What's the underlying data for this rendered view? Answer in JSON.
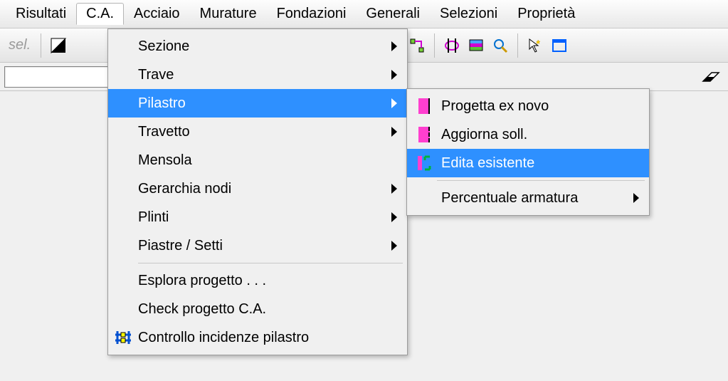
{
  "menubar": {
    "items": [
      "Risultati",
      "C.A.",
      "Acciaio",
      "Murature",
      "Fondazioni",
      "Generali",
      "Selezioni",
      "Proprietà"
    ],
    "active_index": 1
  },
  "toolbar": {
    "sel_label": "sel."
  },
  "ca_menu": {
    "items": [
      {
        "label": "Sezione",
        "has_sub": true
      },
      {
        "label": "Trave",
        "has_sub": true
      },
      {
        "label": "Pilastro",
        "has_sub": true,
        "highlight": true
      },
      {
        "label": "Travetto",
        "has_sub": true
      },
      {
        "label": "Mensola",
        "has_sub": false
      },
      {
        "label": "Gerarchia nodi",
        "has_sub": true
      },
      {
        "label": "Plinti",
        "has_sub": true
      },
      {
        "label": "Piastre / Setti",
        "has_sub": true
      }
    ],
    "items2": [
      {
        "label": "Esplora progetto . . .",
        "has_sub": false
      },
      {
        "label": "Check progetto C.A.",
        "has_sub": false
      },
      {
        "label": "Controllo incidenze pilastro",
        "has_sub": false,
        "icon": "controllo"
      }
    ]
  },
  "pilastro_menu": {
    "items": [
      {
        "label": "Progetta ex novo",
        "icon": "pink-solid"
      },
      {
        "label": "Aggiorna soll.",
        "icon": "pink-dotted"
      },
      {
        "label": "Edita esistente",
        "icon": "green-edit",
        "highlight": true
      }
    ],
    "items2": [
      {
        "label": "Percentuale armatura",
        "has_sub": true
      }
    ]
  }
}
